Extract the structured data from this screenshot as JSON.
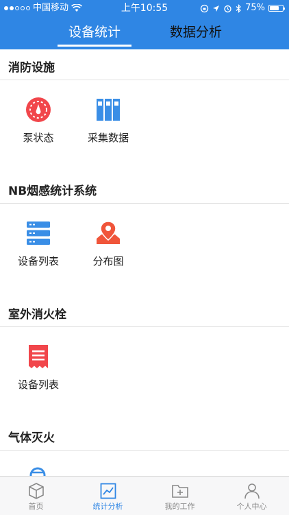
{
  "status": {
    "carrier": "中国移动",
    "time": "上午10:55",
    "battery": "75%",
    "battery_level": 0.75
  },
  "tabs": [
    {
      "label": "设备统计",
      "active": true
    },
    {
      "label": "数据分析",
      "active": false
    }
  ],
  "sections": [
    {
      "title": "消防设施",
      "items": [
        {
          "label": "泵状态",
          "icon": "gauge-icon"
        },
        {
          "label": "采集数据",
          "icon": "binders-icon"
        }
      ]
    },
    {
      "title": "NB烟感统计系统",
      "items": [
        {
          "label": "设备列表",
          "icon": "server-list-icon"
        },
        {
          "label": "分布图",
          "icon": "map-pin-icon"
        }
      ]
    },
    {
      "title": "室外消火栓",
      "items": [
        {
          "label": "设备列表",
          "icon": "receipt-list-icon"
        }
      ]
    },
    {
      "title": "气体灭火",
      "items": []
    }
  ],
  "bottom_nav": [
    {
      "label": "首页",
      "icon": "cube-icon",
      "active": false
    },
    {
      "label": "统计分析",
      "icon": "chart-icon",
      "active": true
    },
    {
      "label": "我的工作",
      "icon": "folder-plus-icon",
      "active": false
    },
    {
      "label": "个人中心",
      "icon": "person-icon",
      "active": false
    }
  ],
  "colors": {
    "primary": "#2f86e4",
    "accent_red": "#f1464b",
    "accent_orange": "#f0553a",
    "icon_blue": "#3a8ee6"
  }
}
